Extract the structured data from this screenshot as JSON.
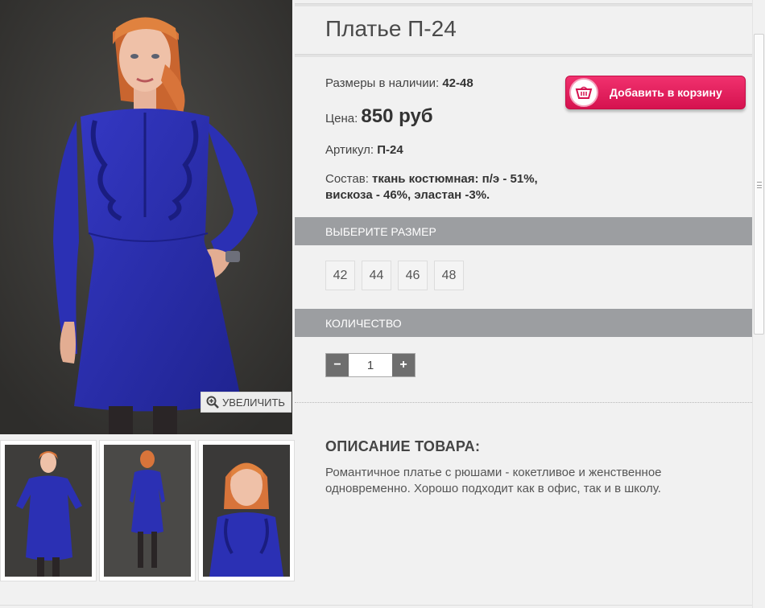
{
  "product": {
    "title": "Платье П-24",
    "sizes_label": "Размеры в наличии:",
    "sizes_value": "42-48",
    "price_label": "Цена:",
    "price_value": "850 руб",
    "article_label": "Артикул:",
    "article_value": "П-24",
    "composition_label": "Состав:",
    "composition_value": "ткань костюмная: п/э - 51%, вискоза - 46%, эластан -3%."
  },
  "cart_button": {
    "label": "Добавить в корзину",
    "icon": "basket-icon"
  },
  "gallery": {
    "zoom_label": "УВЕЛИЧИТЬ",
    "zoom_icon": "zoom-in-icon",
    "thumbnails": [
      "front-view",
      "back-view",
      "closeup-view"
    ]
  },
  "size_section": {
    "header": "ВЫБЕРИТЕ РАЗМЕР",
    "options": [
      "42",
      "44",
      "46",
      "48"
    ]
  },
  "quantity_section": {
    "header": "КОЛИЧЕСТВО",
    "minus": "−",
    "plus": "+",
    "value": "1"
  },
  "description": {
    "title": "ОПИСАНИЕ ТОВАРА:",
    "text": "Романтичное платье с рюшами - кокетливое и женственное одновременно. Хорошо подходит как в офис, так и в школу."
  },
  "colors": {
    "dress": "#2a2fb8",
    "accent_button": "#e11f5c",
    "section_bar": "#9c9ea1",
    "hair": "#d8743a",
    "background": "#3a3a38"
  }
}
